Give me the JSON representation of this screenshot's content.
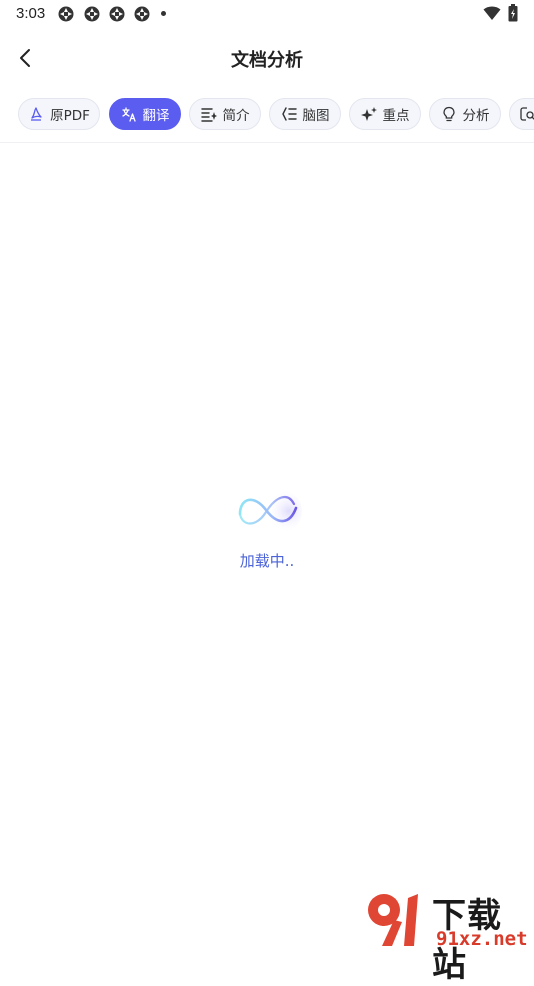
{
  "status_bar": {
    "time": "3:03",
    "notification_icons": [
      "notification-icon",
      "notification-icon",
      "notification-icon",
      "notification-icon"
    ]
  },
  "header": {
    "title": "文档分析",
    "back_icon": "chevron-left-icon"
  },
  "tabs": [
    {
      "label": "原PDF",
      "icon": "pdf-icon",
      "active": false
    },
    {
      "label": "翻译",
      "icon": "translate-icon",
      "active": true
    },
    {
      "label": "简介",
      "icon": "summary-icon",
      "active": false
    },
    {
      "label": "脑图",
      "icon": "mindmap-icon",
      "active": false
    },
    {
      "label": "重点",
      "icon": "sparkle-icon",
      "active": false
    },
    {
      "label": "分析",
      "icon": "lightbulb-icon",
      "active": false
    },
    {
      "label": "",
      "icon": "search-doc-icon",
      "active": false
    }
  ],
  "loading": {
    "text": "加载中.."
  },
  "watermark": {
    "title": "下载站",
    "url": "91xz.net"
  },
  "colors": {
    "accent": "#5b5cf0",
    "loading_text": "#4b63d6",
    "watermark_red": "#d93b2b"
  }
}
